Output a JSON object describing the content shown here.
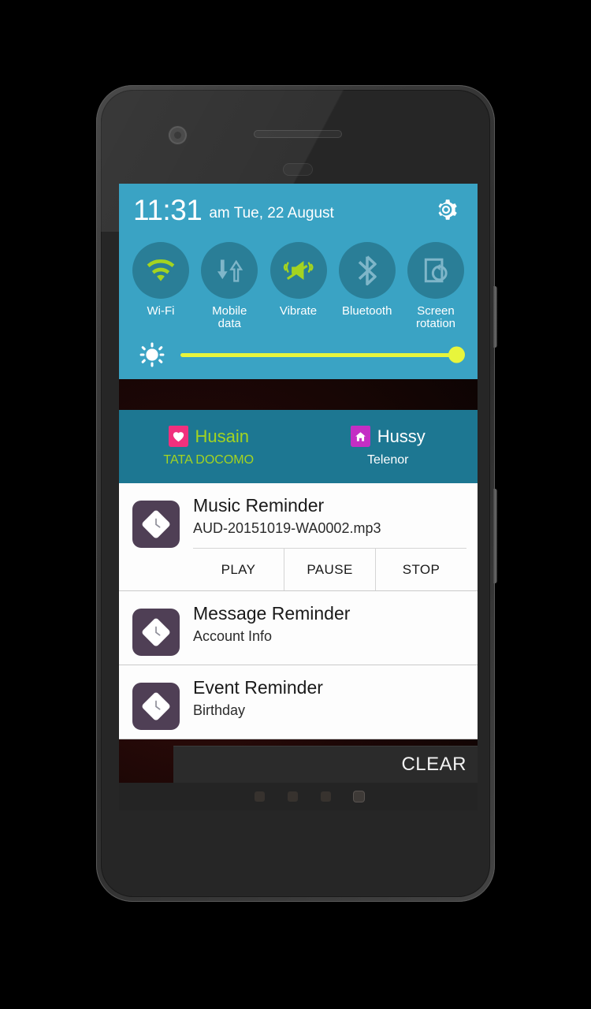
{
  "statusbar": {
    "time": "11:31",
    "date": "am Tue, 22 August",
    "settings_icon": "gear-icon"
  },
  "quick_settings": {
    "toggles": [
      {
        "label": "Wi-Fi",
        "icon": "wifi-icon",
        "active": true
      },
      {
        "label": "Mobile\ndata",
        "icon": "mobile-data-icon",
        "active": false
      },
      {
        "label": "Vibrate",
        "icon": "vibrate-icon",
        "active": true
      },
      {
        "label": "Bluetooth",
        "icon": "bluetooth-icon",
        "active": false
      },
      {
        "label": "Screen\nrotation",
        "icon": "screen-rotation-icon",
        "active": false
      }
    ],
    "brightness": {
      "icon": "brightness-icon",
      "value": 97,
      "track_color": "#e8f53c"
    },
    "colors": {
      "header_bg": "#3aa3c4",
      "circle_bg": "#2a7e97",
      "active_icon": "#a4d420",
      "inactive_icon": "#7fb6c9"
    }
  },
  "sim_row": {
    "background": "#1d7792",
    "sims": [
      {
        "name": "Husain",
        "carrier": "TATA DOCOMO",
        "badge_icon": "heart-icon",
        "badge_color": "#f0307d",
        "text_color": "#a4d420"
      },
      {
        "name": "Hussy",
        "carrier": "Telenor",
        "badge_icon": "home-icon",
        "badge_color": "#c42ec4",
        "text_color": "#ffffff"
      }
    ]
  },
  "notifications": [
    {
      "app_icon": "clock-diamond-icon",
      "title": "Music Reminder",
      "subtitle": "AUD-20151019-WA0002.mp3",
      "actions": [
        "PLAY",
        "PAUSE",
        "STOP"
      ]
    },
    {
      "app_icon": "clock-diamond-icon",
      "title": "Message Reminder",
      "subtitle": "Account Info",
      "actions": []
    },
    {
      "app_icon": "clock-diamond-icon",
      "title": "Event Reminder",
      "subtitle": "Birthday",
      "actions": []
    }
  ],
  "footer": {
    "clear_label": "CLEAR",
    "page_dots": {
      "count": 4,
      "active_index": 3
    }
  }
}
